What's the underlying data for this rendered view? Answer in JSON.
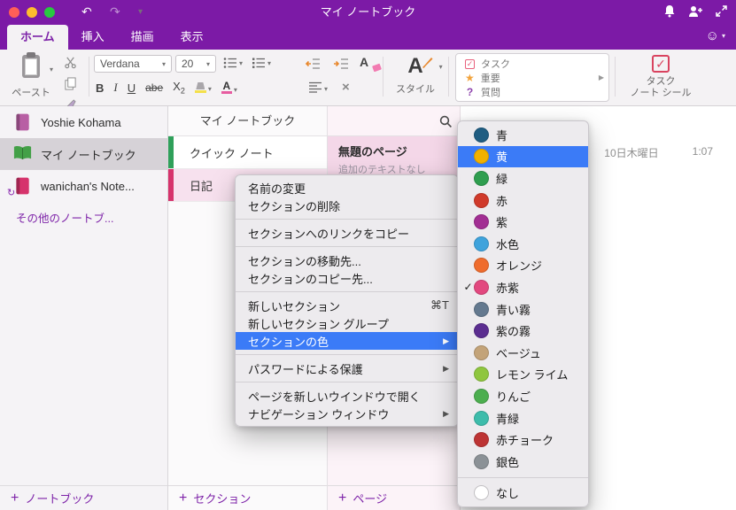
{
  "colors": {
    "titlebar": "#7c1aa6",
    "accent": "#7d22a8",
    "menu_highlight": "#3b7bf7"
  },
  "icons": {
    "undo": "↶",
    "redo": "↷",
    "chevron_down": "▾",
    "smiley": "☺",
    "check": "✓",
    "arrow_right": "▶",
    "star": "★",
    "question": "?",
    "plus": "+",
    "sync": "↻",
    "close": "×"
  },
  "titlebar": {
    "title": "マイ ノートブック"
  },
  "tabs": [
    {
      "label": "ホーム"
    },
    {
      "label": "挿入"
    },
    {
      "label": "描画"
    },
    {
      "label": "表示"
    }
  ],
  "ribbon": {
    "paste_label": "ペースト",
    "font_name": "Verdana",
    "font_size": "20",
    "bold": "B",
    "italic": "I",
    "underline": "U",
    "strikethrough": "abe",
    "subscript_base": "X",
    "subscript_sub": "2",
    "style_label": "スタイル",
    "tags": [
      {
        "label": "タスク"
      },
      {
        "label": "重要"
      },
      {
        "label": "質問"
      }
    ],
    "task_seal_line1": "タスク",
    "task_seal_line2": "ノート シール"
  },
  "sidebar": {
    "notebooks": [
      {
        "label": "Yoshie Kohama",
        "color": "#b85fa4"
      },
      {
        "label": "マイ ノートブック",
        "color": "#43a047"
      },
      {
        "label": "wanichan's Note...",
        "color": "#d6336c"
      }
    ],
    "more_link": "その他のノートブ...",
    "add_label": "ノートブック"
  },
  "sections": {
    "header": "マイ ノートブック",
    "items": [
      {
        "label": "クイック ノート",
        "color": "#2fa05a"
      },
      {
        "label": "日記",
        "color": "#d6336c"
      }
    ],
    "add_label": "セクション"
  },
  "pages": {
    "items": [
      {
        "title": "無題のページ",
        "subtitle": "追加のテキストなし"
      }
    ],
    "add_label": "ページ"
  },
  "canvas": {
    "date": "10日木曜日",
    "time": "1:07"
  },
  "context_menu": {
    "items": [
      {
        "type": "item",
        "label": "名前の変更"
      },
      {
        "type": "item",
        "label": "セクションの削除"
      },
      {
        "type": "sep"
      },
      {
        "type": "item",
        "label": "セクションへのリンクをコピー"
      },
      {
        "type": "sep"
      },
      {
        "type": "item",
        "label": "セクションの移動先..."
      },
      {
        "type": "item",
        "label": "セクションのコピー先..."
      },
      {
        "type": "sep"
      },
      {
        "type": "item",
        "label": "新しいセクション",
        "shortcut": "⌘T"
      },
      {
        "type": "item",
        "label": "新しいセクション グループ"
      },
      {
        "type": "item",
        "label": "セクションの色",
        "submenu": true,
        "highlighted": true
      },
      {
        "type": "sep"
      },
      {
        "type": "item",
        "label": "パスワードによる保護",
        "submenu": true
      },
      {
        "type": "sep"
      },
      {
        "type": "item",
        "label": "ページを新しいウインドウで開く"
      },
      {
        "type": "item",
        "label": "ナビゲーション ウィンドウ",
        "submenu": true
      }
    ]
  },
  "color_menu": {
    "items": [
      {
        "label": "青",
        "color": "#1f5d82"
      },
      {
        "label": "黄",
        "color": "#f2b100",
        "highlighted": true
      },
      {
        "label": "緑",
        "color": "#2f9e4f"
      },
      {
        "label": "赤",
        "color": "#d03a2b"
      },
      {
        "label": "紫",
        "color": "#a22e93"
      },
      {
        "label": "水色",
        "color": "#3fa3dc"
      },
      {
        "label": "オレンジ",
        "color": "#ef6c2d"
      },
      {
        "label": "赤紫",
        "color": "#e2487f",
        "checked": true
      },
      {
        "label": "青い霧",
        "color": "#64798f"
      },
      {
        "label": "紫の霧",
        "color": "#5b2d90"
      },
      {
        "label": "ベージュ",
        "color": "#c3a379"
      },
      {
        "label": "レモン ライム",
        "color": "#8fc63f"
      },
      {
        "label": "りんご",
        "color": "#4cae4f"
      },
      {
        "label": "青緑",
        "color": "#3dbcab"
      },
      {
        "label": "赤チョーク",
        "color": "#bd3434"
      },
      {
        "label": "銀色",
        "color": "#8b9196"
      },
      {
        "label": "なし",
        "color": "#ffffff",
        "none": true
      }
    ]
  }
}
